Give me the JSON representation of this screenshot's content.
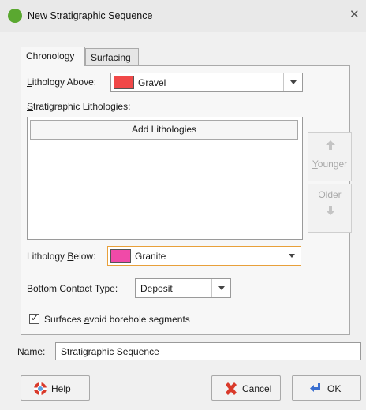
{
  "window": {
    "title": "New Stratigraphic Sequence"
  },
  "tabs": [
    {
      "label": "Chronology",
      "active": true
    },
    {
      "label": "Surfacing",
      "active": false
    }
  ],
  "lithology_above": {
    "label_pre": "",
    "label_u": "L",
    "label_post": "ithology Above:",
    "value": "Gravel",
    "color": "#f04848"
  },
  "stratigraphic": {
    "label_u": "S",
    "label_post": "tratigraphic Lithologies:",
    "add_button": "Add Lithologies"
  },
  "side_buttons": {
    "younger_u": "Y",
    "younger_post": "ounger",
    "older": "Older"
  },
  "lithology_below": {
    "label_pre": "Lithology ",
    "label_u": "B",
    "label_post": "elow:",
    "value": "Granite",
    "color": "#f04aa8"
  },
  "bottom_contact": {
    "label_pre": "Bottom Contact ",
    "label_u": "T",
    "label_post": "ype:",
    "value": "Deposit"
  },
  "surfaces_checkbox": {
    "label_pre": "Surfaces ",
    "label_u": "a",
    "label_post": "void borehole segments",
    "checked": true
  },
  "name": {
    "label_u": "N",
    "label_post": "ame:",
    "value": "Stratigraphic Sequence"
  },
  "buttons": {
    "help_u": "H",
    "help_post": "elp",
    "cancel_u": "C",
    "cancel_post": "ancel",
    "ok_u": "O",
    "ok_post": "K"
  },
  "colors": {
    "app_icon": "#5aa830",
    "focus": "#e8a03a",
    "cancel_icon": "#d93a2b",
    "ok_icon": "#3a6fd0",
    "help_icon": "#d93a2b"
  }
}
